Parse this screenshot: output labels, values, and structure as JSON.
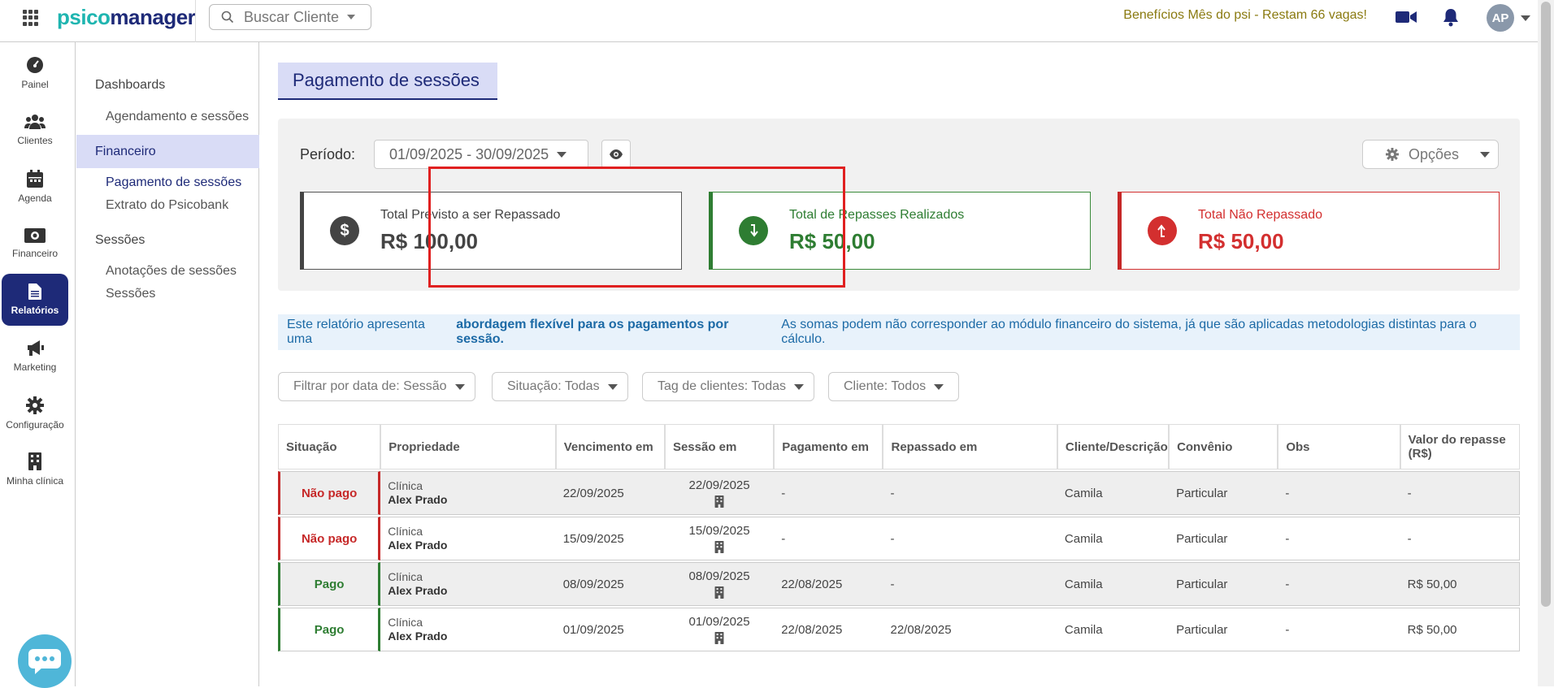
{
  "topbar": {
    "logo_part1": "psico",
    "logo_part2": "manager",
    "search_placeholder": "Buscar Cliente",
    "promo": "Benefícios Mês do psi - Restam 66 vagas!",
    "avatar_initials": "AP"
  },
  "rail": {
    "items": [
      {
        "label": "Painel",
        "icon": "gauge-icon"
      },
      {
        "label": "Clientes",
        "icon": "users-icon"
      },
      {
        "label": "Agenda",
        "icon": "calendar-icon"
      },
      {
        "label": "Financeiro",
        "icon": "money-icon"
      },
      {
        "label": "Relatórios",
        "icon": "document-icon",
        "active": true
      },
      {
        "label": "Marketing",
        "icon": "megaphone-icon"
      },
      {
        "label": "Configuração",
        "icon": "gear-icon"
      },
      {
        "label": "Minha clínica",
        "icon": "building-icon"
      }
    ]
  },
  "subnav": {
    "dashboards": "Dashboards",
    "agendamento": "Agendamento e sessões",
    "financeiro": "Financeiro",
    "pagamento": "Pagamento de sessões",
    "extrato": "Extrato do Psicobank",
    "sessoes_head": "Sessões",
    "anotacoes": "Anotações de sessões",
    "sessoes_link": "Sessões"
  },
  "main": {
    "title": "Pagamento de sessões",
    "periodo_label": "Período:",
    "periodo_value": "01/09/2025 - 30/09/2025",
    "opcoes": "Opções",
    "cards": {
      "previsto_label": "Total Previsto a ser Repassado",
      "previsto_value": "R$ 100,00",
      "realizados_label": "Total de Repasses Realizados",
      "realizados_value": "R$ 50,00",
      "nao_label": "Total Não Repassado",
      "nao_value": "R$ 50,00"
    },
    "info": {
      "part1": "Este relatório apresenta uma",
      "bold": "abordagem flexível para os pagamentos por sessão.",
      "part2": "As somas podem não corresponder ao módulo financeiro do sistema, já que são aplicadas metodologias distintas para o cálculo."
    },
    "filters": {
      "data": "Filtrar por data de: Sessão",
      "situacao": "Situação: Todas",
      "tag": "Tag de clientes: Todas",
      "cliente": "Cliente: Todos"
    }
  },
  "table": {
    "headers": [
      "Situação",
      "Propriedade",
      "Vencimento em",
      "Sessão em",
      "Pagamento em",
      "Repassado em",
      "Cliente/Descrição",
      "Convênio",
      "Obs",
      "Valor do repasse (R$)"
    ],
    "rows": [
      {
        "situacao": "Não pago",
        "prop1": "Clínica",
        "prop2": "Alex Prado",
        "vencimento": "22/09/2025",
        "sessao": "22/09/2025",
        "pagamento": "-",
        "repassado": "-",
        "cliente": "Camila",
        "convenio": "Particular",
        "obs": "-",
        "valor": "-"
      },
      {
        "situacao": "Não pago",
        "prop1": "Clínica",
        "prop2": "Alex Prado",
        "vencimento": "15/09/2025",
        "sessao": "15/09/2025",
        "pagamento": "-",
        "repassado": "-",
        "cliente": "Camila",
        "convenio": "Particular",
        "obs": "-",
        "valor": "-"
      },
      {
        "situacao": "Pago",
        "prop1": "Clínica",
        "prop2": "Alex Prado",
        "vencimento": "08/09/2025",
        "sessao": "08/09/2025",
        "pagamento": "22/08/2025",
        "repassado": "-",
        "cliente": "Camila",
        "convenio": "Particular",
        "obs": "-",
        "valor": "R$ 50,00"
      },
      {
        "situacao": "Pago",
        "prop1": "Clínica",
        "prop2": "Alex Prado",
        "vencimento": "01/09/2025",
        "sessao": "01/09/2025",
        "pagamento": "22/08/2025",
        "repassado": "22/08/2025",
        "cliente": "Camila",
        "convenio": "Particular",
        "obs": "-",
        "valor": "R$ 50,00"
      }
    ]
  },
  "colors": {
    "brand_navy": "#1e2a78",
    "brand_teal": "#1fb5b0",
    "green": "#2e7d32",
    "red": "#d32f2f",
    "highlight": "#e02020"
  }
}
